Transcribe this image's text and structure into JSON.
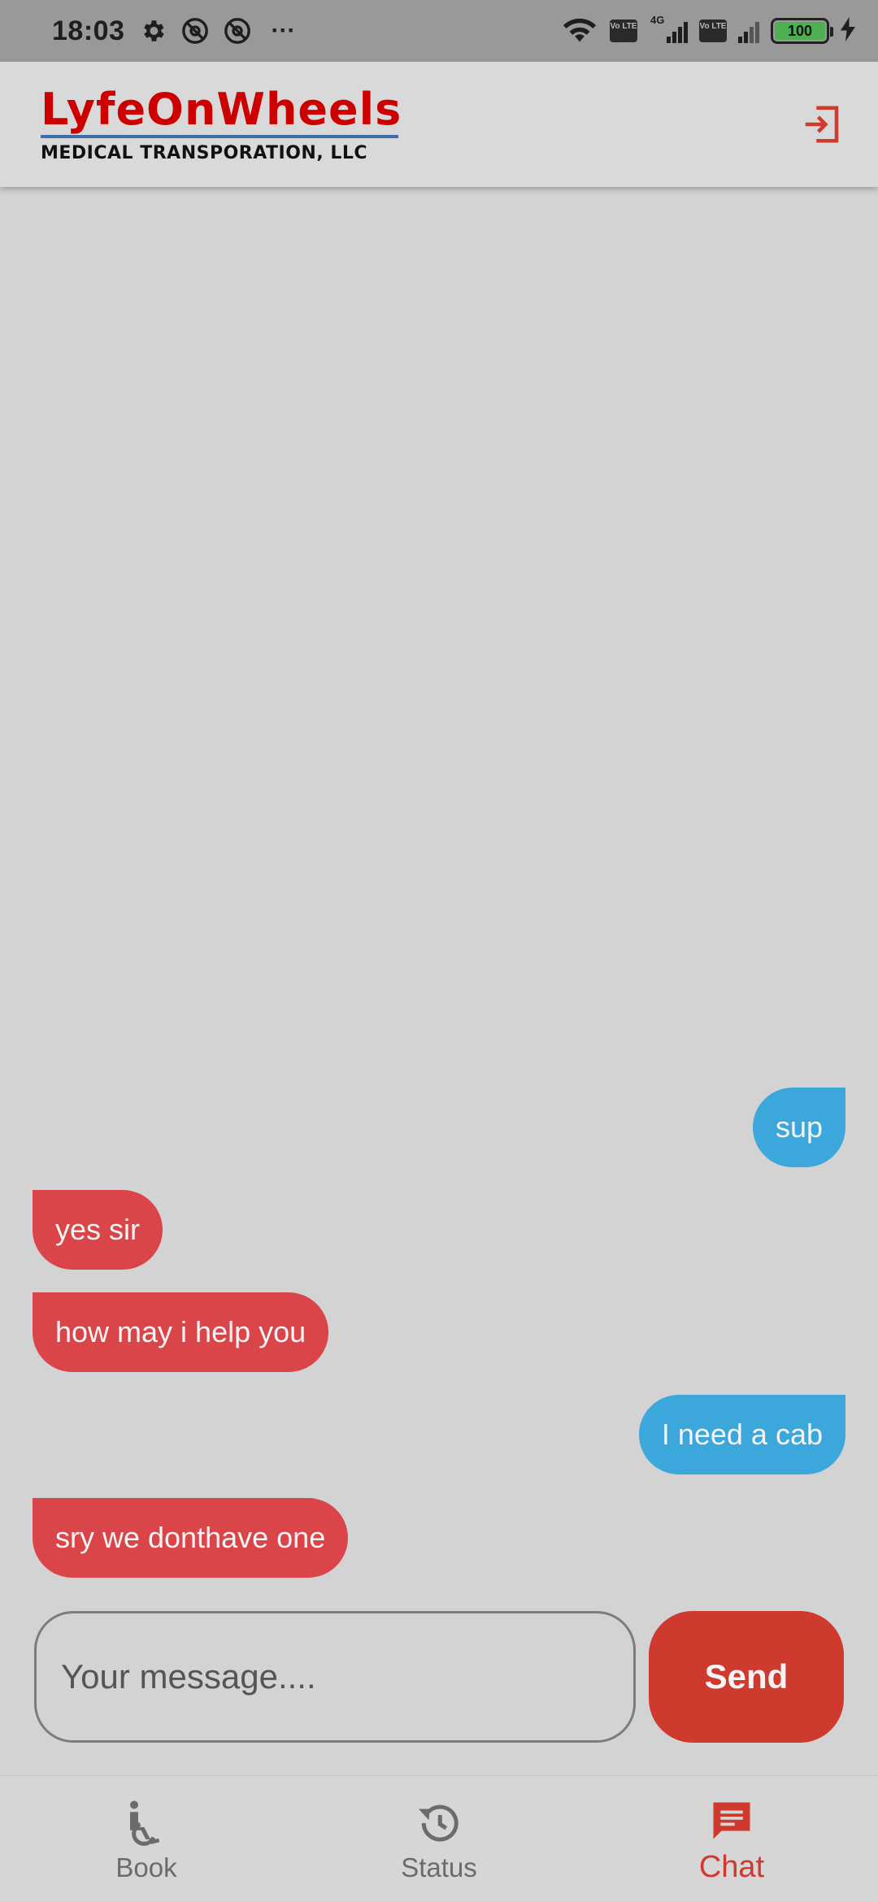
{
  "status_bar": {
    "time": "18:03",
    "network": "4G",
    "lte_label": "Vo LTE",
    "battery": "100",
    "more": "···"
  },
  "header": {
    "logo_title": "LyfeOnWheels",
    "logo_subtitle": "MEDICAL TRANSPORATION, LLC",
    "logout_icon": "logout-icon"
  },
  "messages": [
    {
      "text": "sup",
      "direction": "outgoing"
    },
    {
      "text": "yes sir",
      "direction": "incoming"
    },
    {
      "text": "how may i help you",
      "direction": "incoming"
    },
    {
      "text": "I need a cab",
      "direction": "outgoing"
    },
    {
      "text": "sry we donthave one",
      "direction": "incoming"
    }
  ],
  "composer": {
    "placeholder": "Your message....",
    "value": "",
    "send_label": "Send"
  },
  "nav": {
    "items": [
      {
        "label": "Book",
        "icon": "wheelchair-icon",
        "active": false
      },
      {
        "label": "Status",
        "icon": "history-icon",
        "active": false
      },
      {
        "label": "Chat",
        "icon": "chat-icon",
        "active": true
      }
    ]
  },
  "colors": {
    "accent": "#cf3a2f",
    "incoming_bubble": "#d94548",
    "outgoing_bubble": "#3ba7db",
    "background": "#d3d3d3"
  }
}
